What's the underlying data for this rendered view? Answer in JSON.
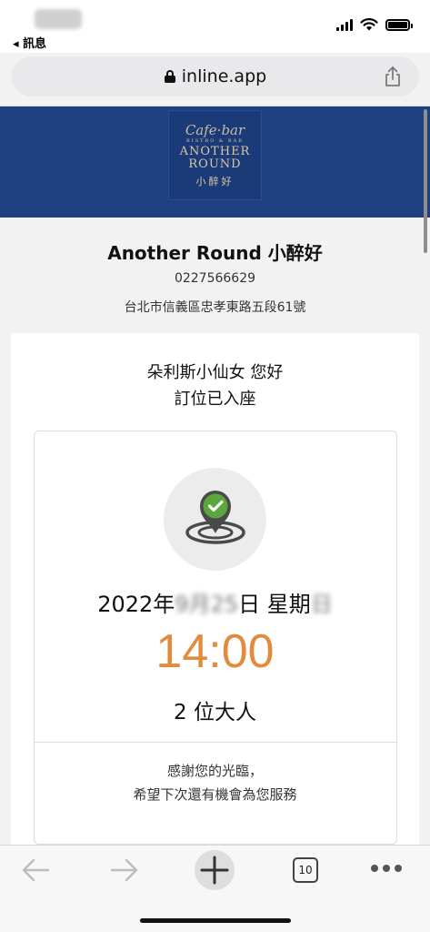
{
  "status_bar": {
    "back_app_label": "◂ 訊息"
  },
  "browser": {
    "url": "inline.app",
    "tab_count": "10"
  },
  "restaurant": {
    "logo_script": "Cafe·bar",
    "logo_small": "BISTRO & BAR",
    "logo_name_line1": "ANOTHER",
    "logo_name_line2": "ROUND",
    "logo_cn": "小醉好",
    "name": "Another Round 小醉好",
    "phone": "0227566629",
    "address": "台北市信義區忠孝東路五段61號"
  },
  "reservation": {
    "greeting": "朵利斯小仙女 您好",
    "status": "訂位已入座",
    "date_year": "2022年",
    "date_month_blur": "9月",
    "date_day_blur": "25",
    "date_day_suffix": "日 星期",
    "date_weekday_blur": "日",
    "time": "14:00",
    "party": "2 位大人",
    "thanks_line1": "感謝您的光臨，",
    "thanks_line2": "希望下次還有機會為您服務"
  },
  "colors": {
    "banner": "#1e4080",
    "time_accent": "#e08c3c",
    "check_green": "#5aa83c"
  }
}
